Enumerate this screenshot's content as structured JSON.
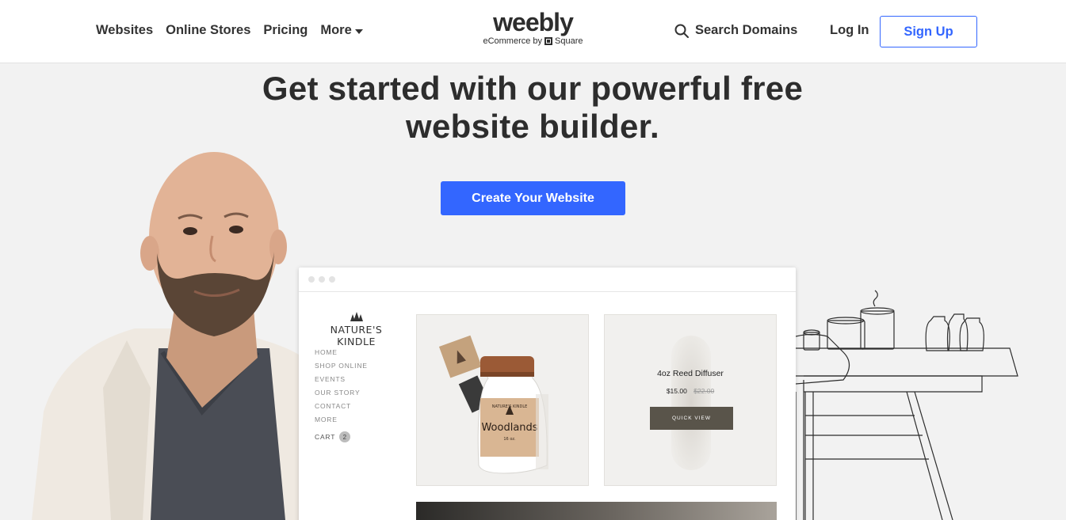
{
  "header": {
    "nav": [
      "Websites",
      "Online Stores",
      "Pricing"
    ],
    "more_label": "More",
    "logo_word": "weebly",
    "logo_sub_prefix": "eCommerce by",
    "logo_sub_brand": "Square",
    "search_label": "Search Domains",
    "login_label": "Log In",
    "signup_label": "Sign Up"
  },
  "hero": {
    "title_line1": "Get started with our powerful free",
    "title_line2": "website builder.",
    "cta_label": "Create Your Website"
  },
  "mockup": {
    "brand": "NATURE'S KINDLE",
    "menu": [
      "HOME",
      "SHOP ONLINE",
      "EVENTS",
      "OUR STORY",
      "CONTACT",
      "MORE"
    ],
    "cart_label": "CART",
    "cart_count": "2",
    "jar_label_top": "NATURE'S KINDLE",
    "jar_label_main": "Woodlands",
    "jar_label_size": "16 oz.",
    "product": {
      "name": "4oz Reed Diffuser",
      "price": "$15.00",
      "old_price": "$22.00",
      "button": "QUICK VIEW"
    }
  },
  "colors": {
    "accent": "#3366ff",
    "background": "#f2f2f2",
    "quick_view": "#59544a"
  },
  "icons": [
    "search-icon",
    "caret-down-icon",
    "square-logo-icon"
  ]
}
